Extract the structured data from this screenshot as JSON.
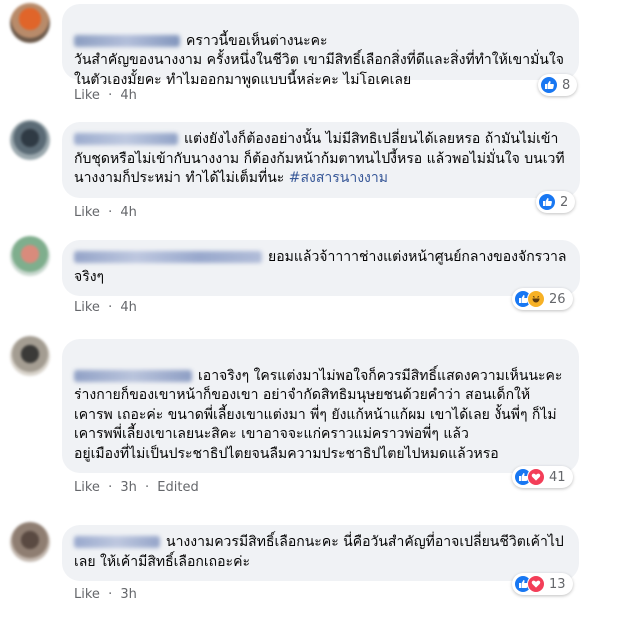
{
  "ui": {
    "like_label": "Like",
    "separator": "·",
    "edited_label": "Edited"
  },
  "comments": [
    {
      "text": "คราวนี้ขอเห็นต่างนะคะ\nวันสำคัญของนางงาม ครั้งหนึ่งในชีวิต เขามีสิทธิ์เลือกสิ่งที่ดีและสิ่งที่ทำให้เขามั่นใจในตัวเองมั้ยคะ ทำไมออกมาพูดแบบนี้หล่ะคะ ไม่โอเคเลย",
      "time": "4h",
      "reaction_count": "8",
      "reactions": [
        "like"
      ]
    },
    {
      "text": "แต่งยังไงก็ต้องอย่างนั้น ไม่มีสิทธิเปลี่ยนได้เลยหรอ ถ้ามันไม่เข้ากับชุดหรือไม่เข้ากับนางงาม ก็ต้องก้มหน้าก้มตาทนไปงี้หรอ แล้วพอไม่มั่นใจ บนเวทีนางงามก็ประหม่า ทำได้ไม่เต็มที่นะ",
      "hashtag": "#สงสารนางงาม",
      "time": "4h",
      "reaction_count": "2",
      "reactions": [
        "like"
      ]
    },
    {
      "text": "ยอมแล้วจ้าาาาช่างแต่งหน้าศูนย์กลางของจักรวาลจริงๆ",
      "time": "4h",
      "reaction_count": "26",
      "reactions": [
        "like",
        "haha"
      ]
    },
    {
      "text": "เอาจริงๆ ใครแต่งมาไม่พอใจก็ควรมีสิทธิ์แสดงความเห็นนะคะ ร่างกายก็ของเขาหน้าก็ของเขา อย่าจำกัดสิทธิมนุษยชนด้วยคำว่า สอนเด็กให้เคารพ เถอะค่ะ ขนาดพี่เลี้ยงเขาแต่งมา พี่ๆ ยังแก้หน้าแก้ผม เขาได้เลย งั้นพี่ๆ ก็ไม่เคารพพี่เลี้ยงเขาเลยนะสิคะ เขาอาจจะแก่คราวแม่คราวพ่อพี่ๆ แล้ว\nอยู่เมืองที่ไม่เป็นประชาธิปไตยจนลืมความประชาธิปไตยไปหมดแล้วหรอ",
      "time": "3h",
      "edited": true,
      "reaction_count": "41",
      "reactions": [
        "like",
        "love"
      ]
    },
    {
      "text": "นางงามควรมีสิทธิ์เลือกนะคะ นี่คือวันสำคัญที่อาจเปลี่ยนชีวิตเค้าไปเลย ให้เค้ามีสิทธิ์เลือกเถอะค่ะ",
      "time": "3h",
      "reaction_count": "13",
      "reactions": [
        "like",
        "love"
      ]
    }
  ],
  "colors": {
    "like": "#1877f2",
    "love": "#f33e58",
    "haha": "#f7b125",
    "hashtag": "#385898",
    "bubble": "#f0f2f5",
    "meta": "#65676b"
  }
}
